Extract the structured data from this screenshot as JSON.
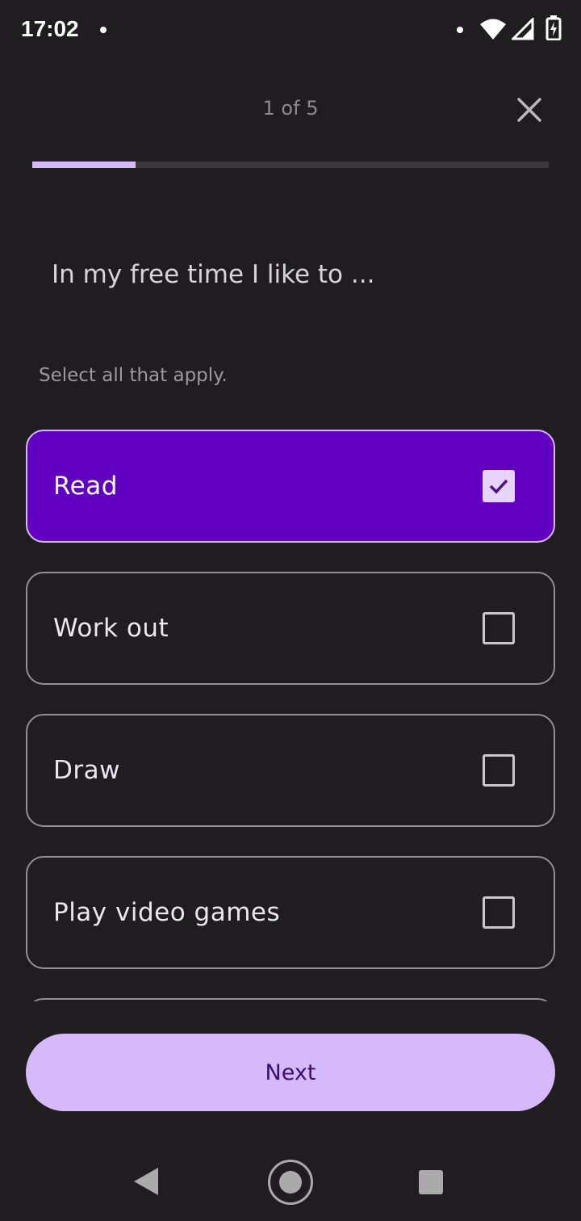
{
  "status_bar": {
    "time": "17:02",
    "icons": [
      "notification-dot-icon",
      "wifi-icon",
      "signal-icon",
      "battery-charging-icon"
    ]
  },
  "header": {
    "step_counter": "1 of 5",
    "progress_fraction": 0.2,
    "close_icon": "close-icon"
  },
  "question": "In my free time I like to ...",
  "hint": "Select all that apply.",
  "options": [
    {
      "label": "Read",
      "selected": true
    },
    {
      "label": "Work out",
      "selected": false
    },
    {
      "label": "Draw",
      "selected": false
    },
    {
      "label": "Play video games",
      "selected": false
    }
  ],
  "next_button": {
    "label": "Next"
  },
  "nav_bar": {
    "icons": [
      "back-icon",
      "home-icon",
      "recents-icon"
    ]
  },
  "colors": {
    "background": "#1f1d20",
    "accent": "#d6b9fb",
    "selected_option": "#6100c0",
    "button_text": "#3c0b74"
  }
}
